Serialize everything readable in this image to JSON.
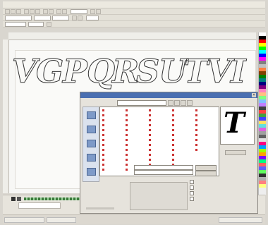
{
  "menubar": {
    "items": [
      "",
      "",
      "",
      "",
      "",
      "",
      "",
      "",
      "",
      "",
      ""
    ]
  },
  "canvas": {
    "text_letters": [
      "V",
      "G",
      "P",
      "Q",
      "R",
      "S",
      "U",
      "T",
      "V",
      "I"
    ]
  },
  "palette": {
    "colors": [
      "#ffffff",
      "#000000",
      "#ff0000",
      "#ffff00",
      "#00ff00",
      "#00ffff",
      "#0000ff",
      "#ff00ff",
      "#808080",
      "#c0c0c0",
      "#ff8040",
      "#804000",
      "#008000",
      "#008080",
      "#000080",
      "#800080",
      "#ff80c0",
      "#ffc080",
      "#80ff80",
      "#80c0ff",
      "#c080ff",
      "#404040",
      "#ff4040",
      "#40a040",
      "#4040ff",
      "#ffe060",
      "#60e0e0",
      "#e060e0",
      "#a0a0a0",
      "#606060",
      "#e0e0e0",
      "#ff0080",
      "#00a0ff",
      "#a0ff00",
      "#ffa000",
      "#8000ff",
      "#00ff80",
      "#ff6060",
      "#6060ff",
      "#60ff60",
      "#303030",
      "#b0b0b0",
      "#ff8080",
      "#ffff80"
    ]
  },
  "dialog": {
    "title": "",
    "look_in_label": "",
    "look_in_value": "",
    "file_columns": [
      [
        "",
        "",
        "",
        "",
        "",
        "",
        "",
        "",
        "",
        "",
        "",
        "",
        ""
      ],
      [
        "",
        "",
        "",
        "",
        "",
        "",
        "",
        "",
        "",
        "",
        "",
        "",
        ""
      ],
      [
        "",
        "",
        "",
        "",
        "",
        "",
        "",
        "",
        "",
        "",
        "",
        "",
        ""
      ],
      [
        "",
        "",
        "",
        "",
        "",
        "",
        "",
        "",
        "",
        "",
        "",
        "",
        ""
      ],
      [
        "",
        "",
        "",
        "",
        "",
        "",
        "",
        "",
        ""
      ]
    ],
    "preview_char": "T",
    "preview_label": "",
    "file_name_label": "",
    "file_type_label": "",
    "file_type_value": "",
    "open_button": "",
    "cancel_button": "",
    "description_label": "",
    "close_symbol": "×"
  }
}
